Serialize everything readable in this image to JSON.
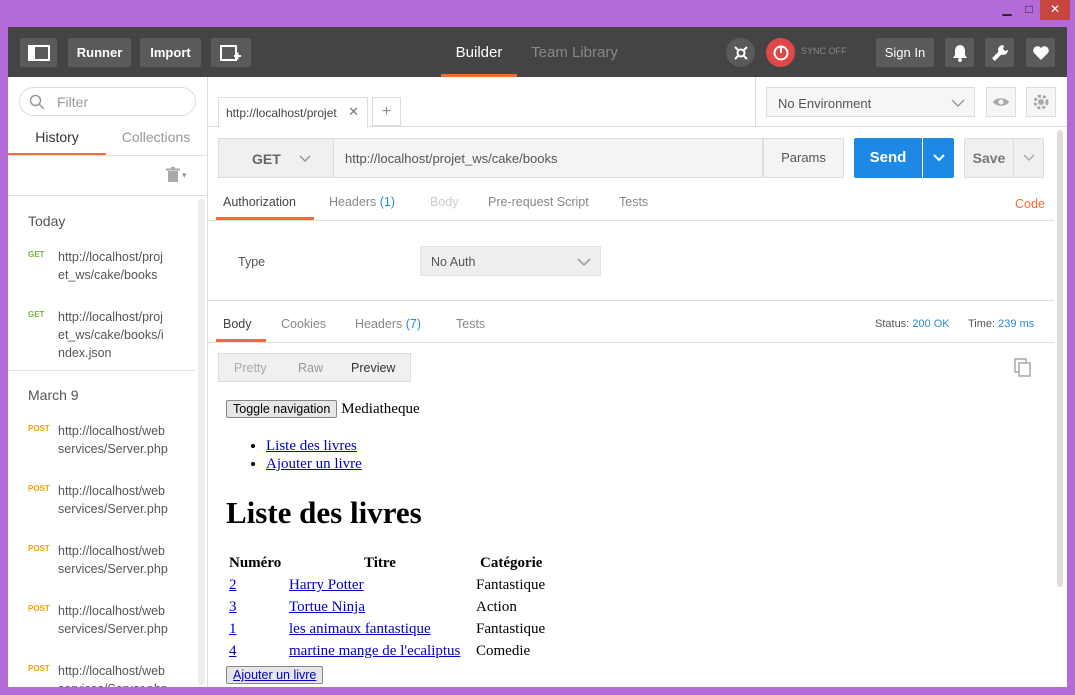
{
  "window": {
    "minimize": "▁",
    "maximize": "□",
    "close": "✕"
  },
  "toolbar": {
    "runner": "Runner",
    "import": "Import",
    "tab_builder": "Builder",
    "tab_team": "Team Library",
    "sync": "SYNC OFF",
    "signin": "Sign In"
  },
  "sidebar": {
    "filter_placeholder": "Filter",
    "tab_history": "History",
    "tab_collections": "Collections",
    "groups": [
      {
        "label": "Today",
        "items": [
          {
            "method": "GET",
            "url": "http://localhost/projet_ws/cake/books"
          },
          {
            "method": "GET",
            "url": "http://localhost/projet_ws/cake/books/index.json"
          }
        ]
      },
      {
        "label": "March 9",
        "items": [
          {
            "method": "POST",
            "url": "http://localhost/webservices/Server.php"
          },
          {
            "method": "POST",
            "url": "http://localhost/webservices/Server.php"
          },
          {
            "method": "POST",
            "url": "http://localhost/webservices/Server.php"
          },
          {
            "method": "POST",
            "url": "http://localhost/webservices/Server.php"
          },
          {
            "method": "POST",
            "url": "http://localhost/webservices/Server.php"
          }
        ]
      }
    ]
  },
  "request": {
    "tab_title": "http://localhost/projet",
    "tab_new": "+",
    "environment": "No Environment",
    "method": "GET",
    "url": "http://localhost/projet_ws/cake/books",
    "params": "Params",
    "send": "Send",
    "save": "Save",
    "tabs": {
      "authorization": "Authorization",
      "headers": "Headers",
      "headers_count": "(1)",
      "body": "Body",
      "prerequest": "Pre-request Script",
      "tests": "Tests",
      "code": "Code"
    },
    "auth_type_label": "Type",
    "auth_type_value": "No Auth"
  },
  "response": {
    "tabs": {
      "body": "Body",
      "cookies": "Cookies",
      "headers": "Headers",
      "headers_count": "(7)",
      "tests": "Tests"
    },
    "status_label": "Status:",
    "status_value": "200 OK",
    "time_label": "Time:",
    "time_value": "239 ms",
    "views": {
      "pretty": "Pretty",
      "raw": "Raw",
      "preview": "Preview"
    },
    "preview": {
      "toggle_nav": "Toggle navigation",
      "brand": "Mediatheque",
      "nav_links": [
        "Liste des livres",
        "Ajouter un livre"
      ],
      "heading": "Liste des livres",
      "table_headers": [
        "Numéro",
        "Titre",
        "Catégorie"
      ],
      "rows": [
        {
          "num": "2",
          "title": "Harry Potter",
          "category": "Fantastique"
        },
        {
          "num": "3",
          "title": "Tortue Ninja",
          "category": "Action"
        },
        {
          "num": "1",
          "title": "les animaux fantastique",
          "category": "Fantastique"
        },
        {
          "num": "4",
          "title": "martine mange de l'ecaliptus",
          "category": "Comedie"
        }
      ],
      "add_button": "Ajouter un livre"
    }
  }
}
